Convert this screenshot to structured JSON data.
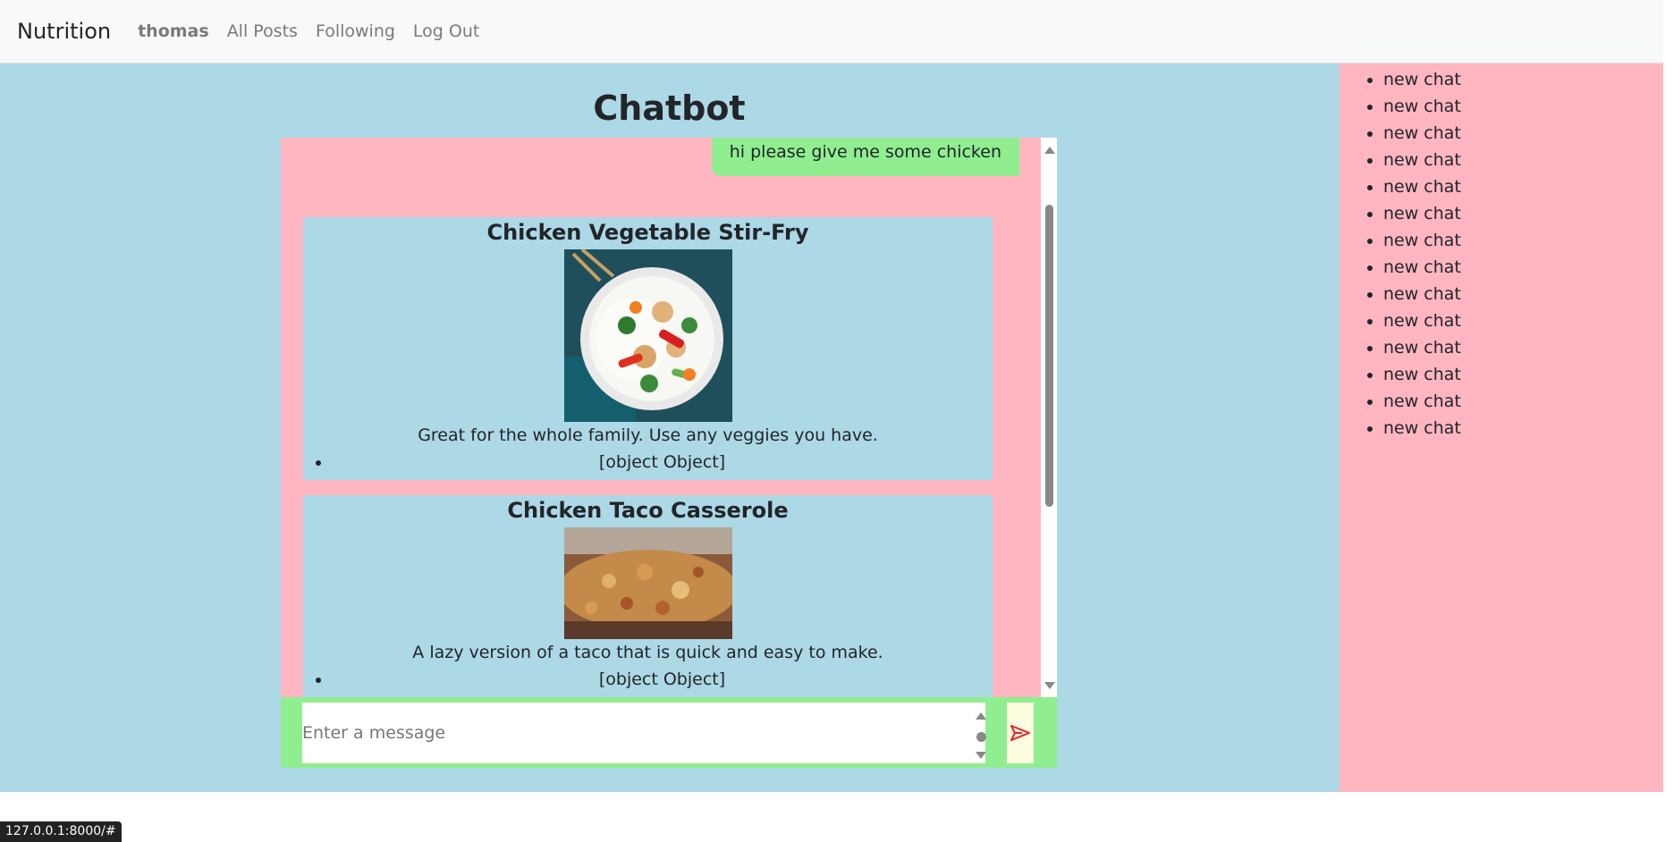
{
  "navbar": {
    "brand": "Nutrition",
    "user": "thomas",
    "links": [
      "All Posts",
      "Following",
      "Log Out"
    ]
  },
  "page_title": "Chatbot",
  "chat": {
    "user_message": "hi please give me some chicken",
    "recipes": [
      {
        "title": "Chicken Vegetable Stir-Fry",
        "description": "Great for the whole family. Use any veggies you have.",
        "list_item": "[object Object]"
      },
      {
        "title": "Chicken Taco Casserole",
        "description": "A lazy version of a taco that is quick and easy to make.",
        "list_item": "[object Object]"
      }
    ]
  },
  "input": {
    "placeholder": "Enter a message"
  },
  "sidebar": {
    "chats": [
      "new chat",
      "new chat",
      "new chat",
      "new chat",
      "new chat",
      "new chat",
      "new chat",
      "new chat",
      "new chat",
      "new chat",
      "new chat",
      "new chat",
      "new chat",
      "new chat"
    ]
  },
  "status_bar": {
    "url": "127.0.0.1:8000/#"
  },
  "colors": {
    "main_bg": "#add8e6",
    "sidebar_bg": "#ffb6c1",
    "input_bar": "#90ee90",
    "send_icon": "#e8202a"
  }
}
